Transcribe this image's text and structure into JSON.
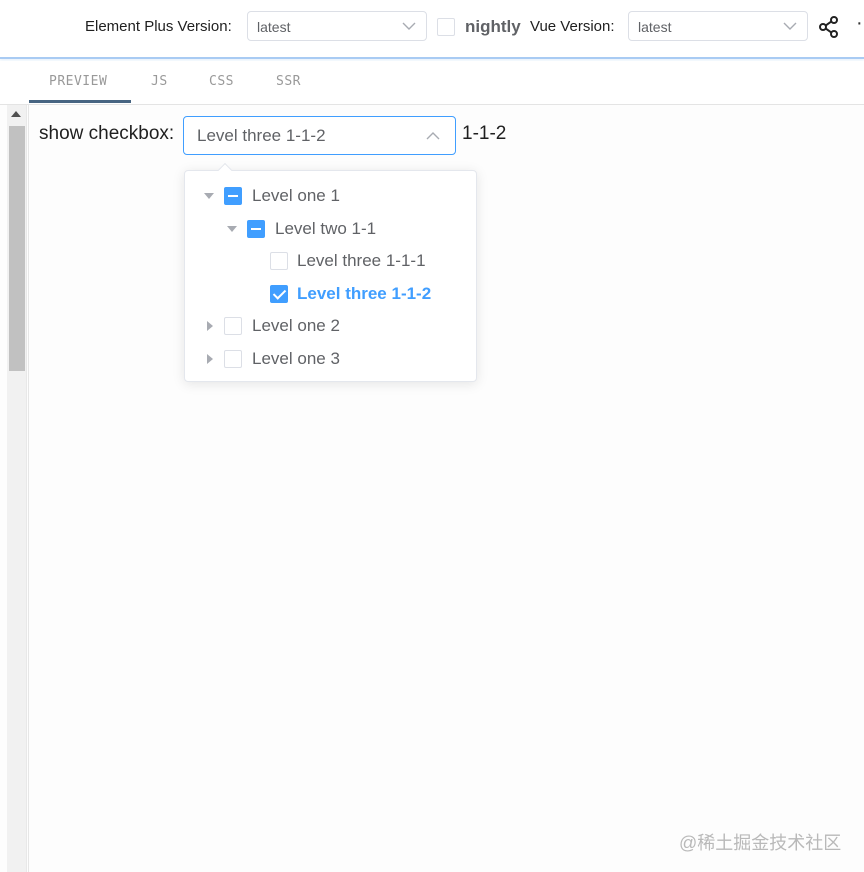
{
  "header": {
    "element_plus_label": "Element Plus Version:",
    "element_plus_value": "latest",
    "nightly_label": "nightly",
    "vue_label": "Vue Version:",
    "vue_value": "latest",
    "share_icon": "share-icon",
    "more_icon": "more-icon"
  },
  "tabs": [
    {
      "label": "PREVIEW",
      "active": true
    },
    {
      "label": "JS",
      "active": false
    },
    {
      "label": "CSS",
      "active": false
    },
    {
      "label": "SSR",
      "active": false
    }
  ],
  "preview": {
    "show_label": "show checkbox:",
    "select_value": "Level three 1-1-2",
    "result_text": "1-1-2"
  },
  "tree": {
    "nodes": [
      {
        "label": "Level one 1",
        "state": "indeterminate",
        "expanded": true
      },
      {
        "label": "Level two 1-1",
        "state": "indeterminate",
        "expanded": true
      },
      {
        "label": "Level three 1-1-1",
        "state": "unchecked"
      },
      {
        "label": "Level three 1-1-2",
        "state": "checked",
        "selected": true
      },
      {
        "label": "Level one 2",
        "state": "unchecked",
        "expanded": false
      },
      {
        "label": "Level one 3",
        "state": "unchecked",
        "expanded": false
      }
    ]
  },
  "watermark": "@稀土掘金技术社区",
  "colors": {
    "accent": "#409eff",
    "tab_active": "#476582"
  }
}
